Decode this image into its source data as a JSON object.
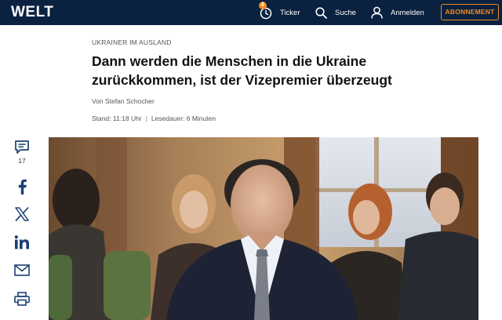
{
  "header": {
    "logo": "WELT",
    "ticker_badge": "6",
    "ticker_label": "Ticker",
    "search_label": "Suche",
    "login_label": "Anmelden",
    "subscribe_label": "ABONNEMENT"
  },
  "article": {
    "kicker": "UKRAINER IM AUSLAND",
    "headline": "Dann werden die Menschen in die Ukraine zurückkommen, ist der Vizepremier überzeugt",
    "byline": "Von Stefan Schocher",
    "time": "Stand: 11:18 Uhr",
    "read_time": "Lesedauer: 6 Minuten"
  },
  "share": {
    "comment_count": "17",
    "icons": [
      "comment-icon",
      "facebook-icon",
      "x-icon",
      "linkedin-icon",
      "mail-icon",
      "print-icon"
    ]
  },
  "colors": {
    "header_bg": "#0b2140",
    "accent": "#f08a24",
    "icon": "#1c3f73"
  }
}
